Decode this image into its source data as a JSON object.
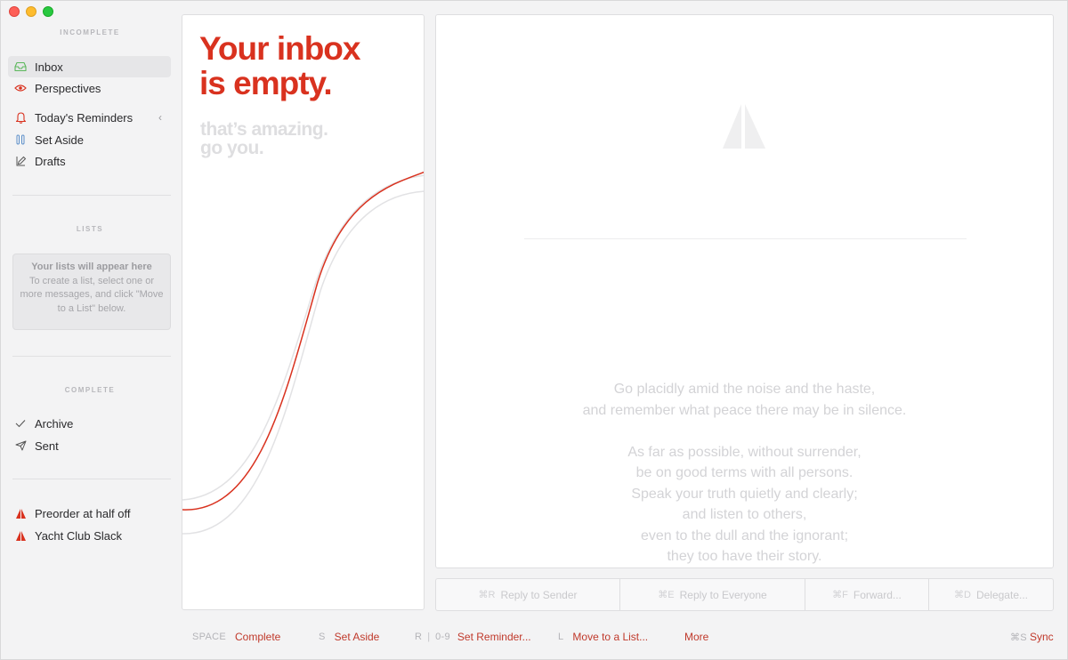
{
  "sidebar": {
    "incomplete_header": "INCOMPLETE",
    "inbox": "Inbox",
    "perspectives": "Perspectives",
    "todays_reminders": "Today's Reminders",
    "set_aside": "Set Aside",
    "drafts": "Drafts",
    "lists_header": "LISTS",
    "lists_empty_title": "Your lists will appear here",
    "lists_empty_body": "To create a list, select one or more messages, and click \"Move to a List\" below.",
    "complete_header": "COMPLETE",
    "archive": "Archive",
    "sent": "Sent",
    "promo_1": "Preorder at half off",
    "promo_2": "Yacht Club Slack"
  },
  "listpane": {
    "title_line1": "Your inbox",
    "title_line2": "is empty.",
    "sub_line1": "that’s amazing.",
    "sub_line2": "go you."
  },
  "reader": {
    "poem": [
      "Go placidly amid the noise and the haste,",
      "and remember what peace there may be in silence.",
      "",
      "As far as possible, without surrender,",
      "be on good terms with all persons.",
      "Speak your truth quietly and clearly;",
      "and listen to others,",
      "even to the dull and the ignorant;",
      "they too have their story."
    ]
  },
  "actions": {
    "reply_sender_key": "⌘R",
    "reply_sender": "Reply to Sender",
    "reply_all_key": "⌘E",
    "reply_all": "Reply to Everyone",
    "forward_key": "⌘F",
    "forward": "Forward...",
    "delegate_key": "⌘D",
    "delegate": "Delegate..."
  },
  "footer": {
    "complete_key": "SPACE",
    "complete": "Complete",
    "set_aside_key": "S",
    "set_aside": "Set Aside",
    "reminder_key_r": "R",
    "reminder_sep": "|",
    "reminder_key_num": "0-9",
    "reminder": "Set Reminder...",
    "move_key": "L",
    "move": "Move to a List...",
    "more": "More",
    "sync_key": "⌘S",
    "sync": "Sync"
  },
  "colors": {
    "accent_red": "#d9321f",
    "link_red": "#c0392b",
    "inbox_icon_green": "#5cb85c",
    "perspectives_icon_red": "#d9321f"
  }
}
